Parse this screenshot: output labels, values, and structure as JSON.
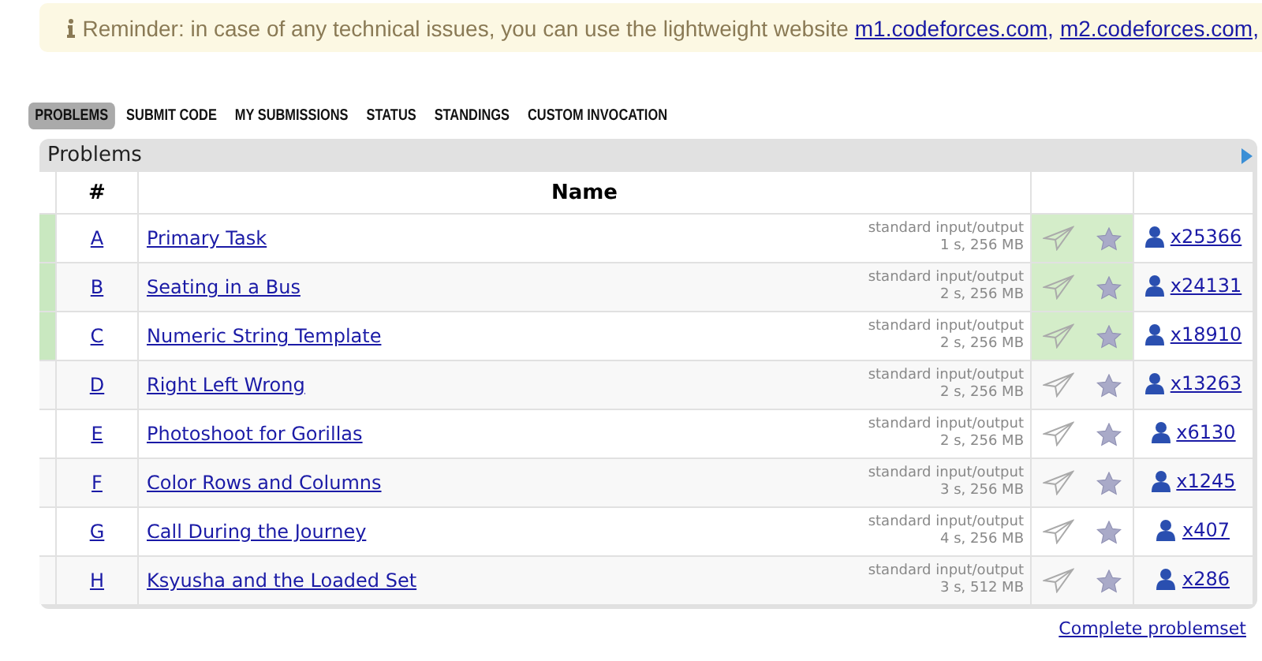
{
  "reminder": {
    "text": "Reminder: in case of any technical issues, you can use the lightweight website",
    "links": [
      "m1.codeforces.com,",
      "m2.codeforces.com,"
    ]
  },
  "tabs": [
    {
      "label": "PROBLEMS",
      "selected": true
    },
    {
      "label": "SUBMIT CODE",
      "selected": false
    },
    {
      "label": "MY SUBMISSIONS",
      "selected": false
    },
    {
      "label": "STATUS",
      "selected": false
    },
    {
      "label": "STANDINGS",
      "selected": false
    },
    {
      "label": "CUSTOM INVOCATION",
      "selected": false
    }
  ],
  "table": {
    "title": "Problems",
    "columns": [
      "#",
      "Name"
    ],
    "rows": [
      {
        "index": "A",
        "name": "Primary Task",
        "io": "standard input/output",
        "limits": "1 s, 256 MB",
        "solved": "x25366",
        "accepted": true
      },
      {
        "index": "B",
        "name": "Seating in a Bus",
        "io": "standard input/output",
        "limits": "2 s, 256 MB",
        "solved": "x24131",
        "accepted": true
      },
      {
        "index": "C",
        "name": "Numeric String Template",
        "io": "standard input/output",
        "limits": "2 s, 256 MB",
        "solved": "x18910",
        "accepted": true
      },
      {
        "index": "D",
        "name": "Right Left Wrong",
        "io": "standard input/output",
        "limits": "2 s, 256 MB",
        "solved": "x13263",
        "accepted": false
      },
      {
        "index": "E",
        "name": "Photoshoot for Gorillas",
        "io": "standard input/output",
        "limits": "2 s, 256 MB",
        "solved": "x6130",
        "accepted": false
      },
      {
        "index": "F",
        "name": "Color Rows and Columns",
        "io": "standard input/output",
        "limits": "3 s, 256 MB",
        "solved": "x1245",
        "accepted": false
      },
      {
        "index": "G",
        "name": "Call During the Journey",
        "io": "standard input/output",
        "limits": "4 s, 256 MB",
        "solved": "x407",
        "accepted": false
      },
      {
        "index": "H",
        "name": "Ksyusha and the Loaded Set",
        "io": "standard input/output",
        "limits": "3 s, 512 MB",
        "solved": "x286",
        "accepted": false
      }
    ]
  },
  "footer_link": "Complete problemset"
}
